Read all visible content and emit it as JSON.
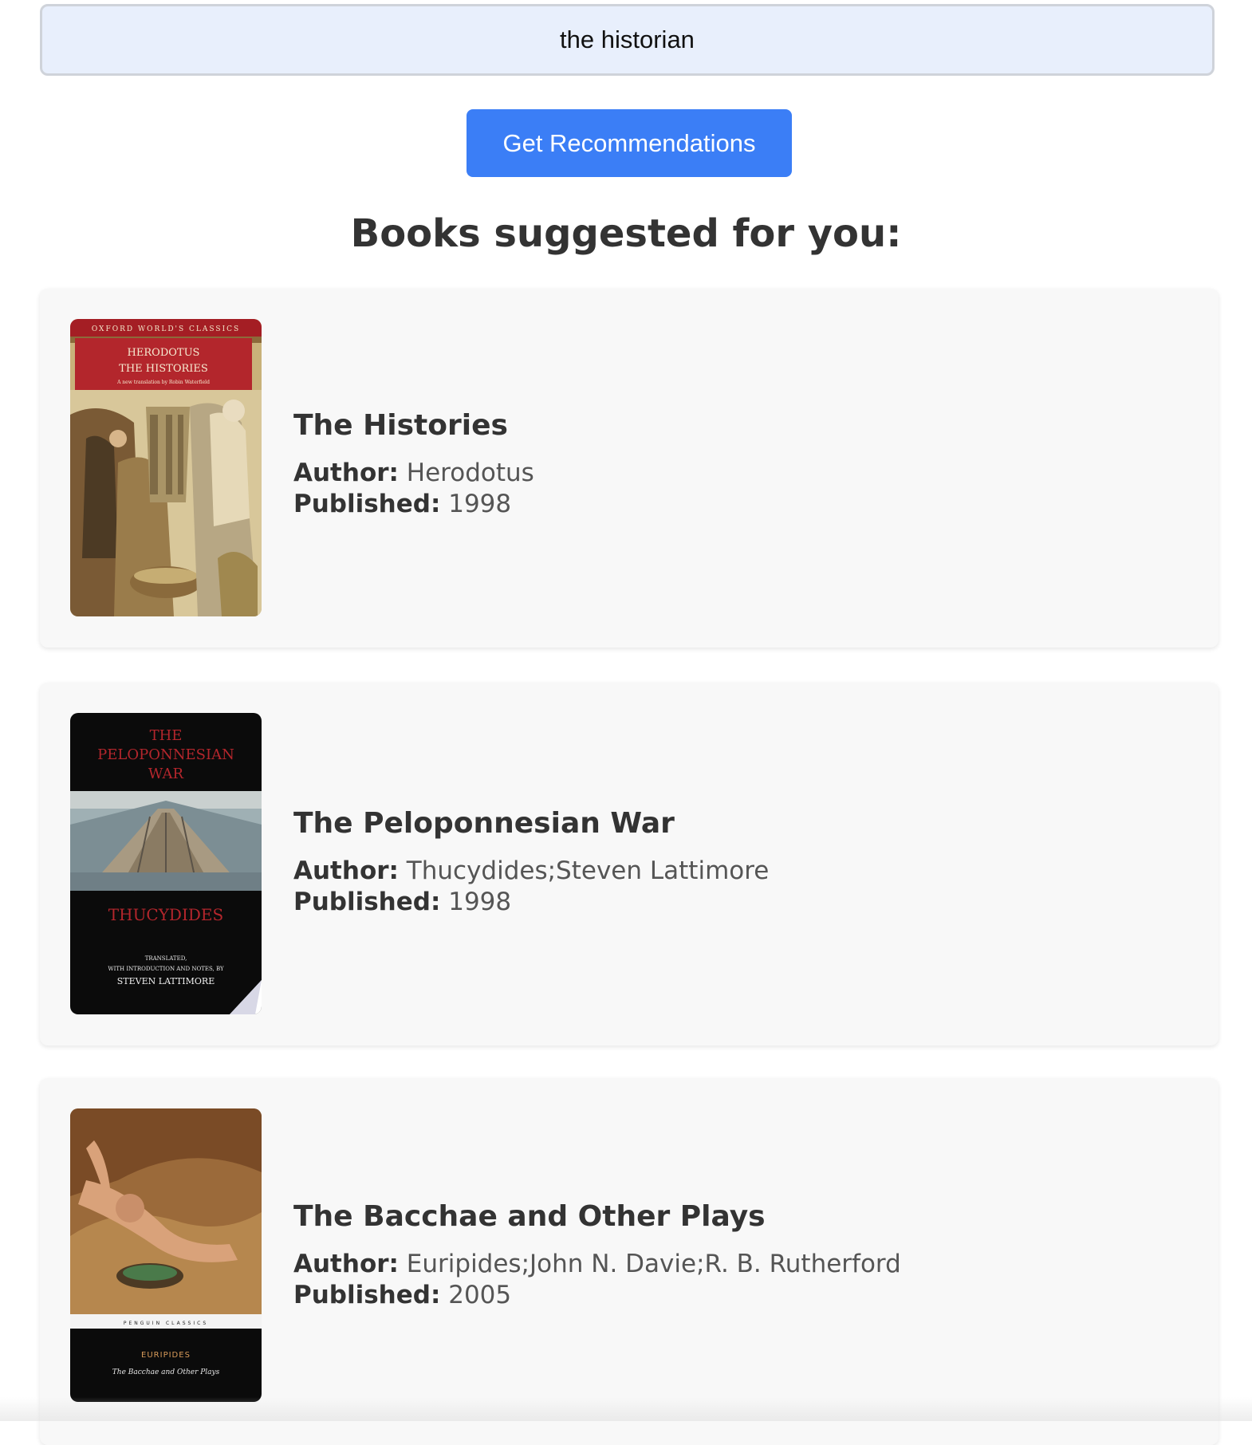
{
  "search": {
    "value": "the historian",
    "button_label": "Get Recommendations"
  },
  "results": {
    "heading": "Books suggested for you:",
    "author_label": "Author:",
    "published_label": "Published:",
    "books": [
      {
        "title": "The Histories",
        "author": "Herodotus",
        "published": "1998",
        "cover": {
          "series": "OXFORD WORLD'S CLASSICS",
          "author": "HERODOTUS",
          "title": "THE HISTORIES",
          "subtitle": "A new translation by Robin Waterfield"
        }
      },
      {
        "title": "The Peloponnesian War",
        "author": "Thucydides;Steven Lattimore",
        "published": "1998",
        "cover": {
          "title_line1": "THE",
          "title_line2": "PELOPONNESIAN",
          "title_line3": "WAR",
          "author": "THUCYDIDES",
          "credit_line1": "TRANSLATED,",
          "credit_line2": "WITH INTRODUCTION AND NOTES, BY",
          "credit_line3": "STEVEN LATTIMORE"
        }
      },
      {
        "title": "The Bacchae and Other Plays",
        "author": "Euripides;John N. Davie;R. B. Rutherford",
        "published": "2005",
        "cover": {
          "series": "PENGUIN CLASSICS",
          "author": "EURIPIDES",
          "title": "The Bacchae and Other Plays"
        }
      }
    ]
  },
  "colors": {
    "button": "#3b7ef6",
    "search_bg": "#e8effc",
    "card_bg": "#f8f8f8"
  }
}
